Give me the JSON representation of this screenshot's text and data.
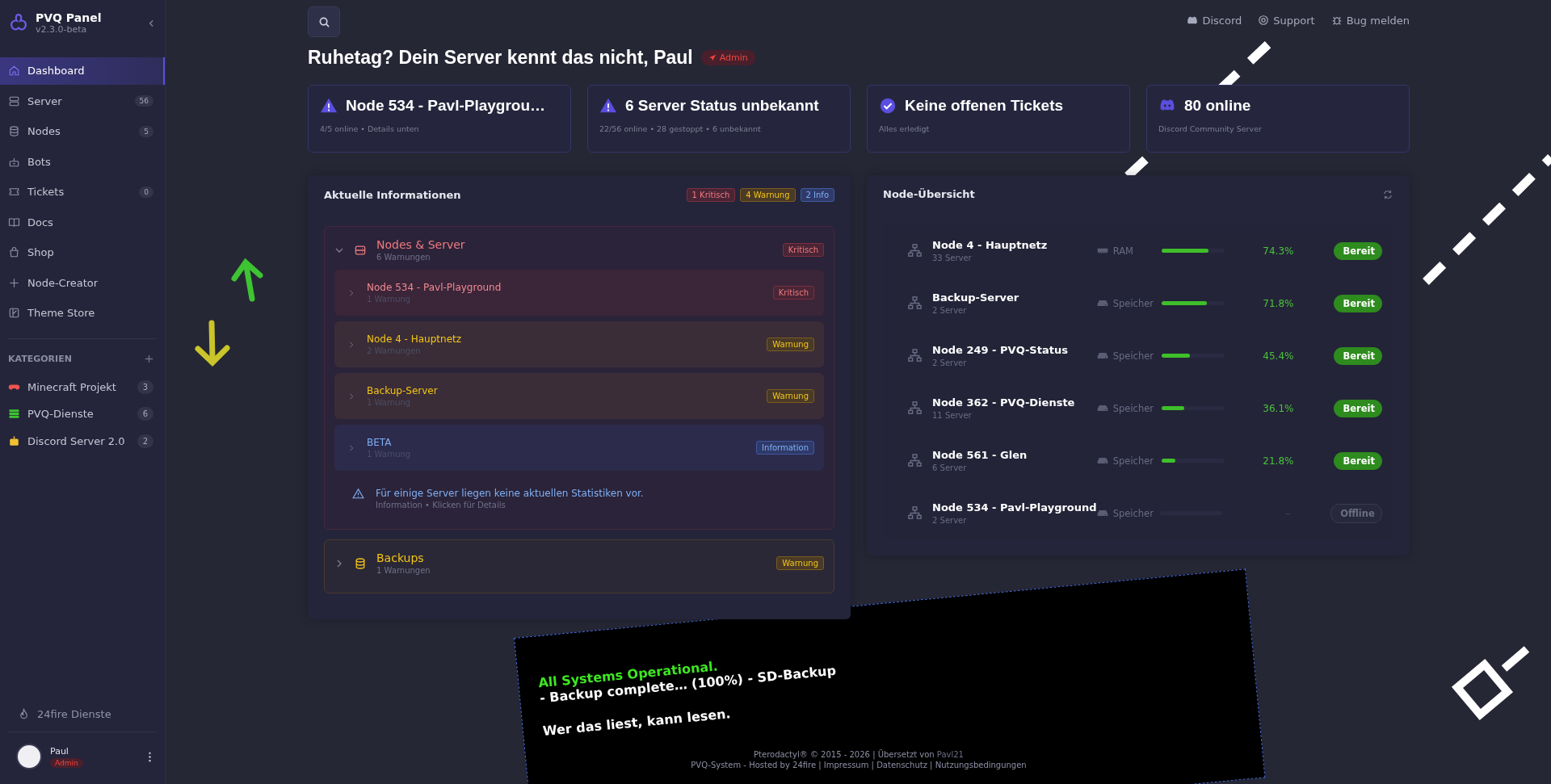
{
  "sidebar": {
    "brand": "PVQ Panel",
    "version": "v2.3.0-beta",
    "items": [
      {
        "label": "Dashboard",
        "selected": true
      },
      {
        "label": "Server",
        "count": "56",
        "selected": false
      },
      {
        "label": "Nodes",
        "count": "5",
        "selected": false
      },
      {
        "label": "Bots",
        "selected": false
      },
      {
        "label": "Tickets",
        "count": "0",
        "selected": false
      },
      {
        "label": "Docs",
        "selected": false
      },
      {
        "label": "Shop",
        "selected": false
      },
      {
        "label": "Node-Creator",
        "selected": false
      },
      {
        "label": "Theme Store",
        "selected": false
      }
    ],
    "categories_heading": "KATEGORIEN",
    "categories": [
      {
        "label": "Minecraft Projekt",
        "count": "3",
        "color": "#ef5350"
      },
      {
        "label": "PVQ-Dienste",
        "count": "6",
        "color": "#3ec432"
      },
      {
        "label": "Discord Server 2.0",
        "count": "2",
        "color": "#f2c230"
      }
    ],
    "footer_link": "24fire Dienste",
    "user": {
      "name": "Paul",
      "role": "Admin"
    }
  },
  "topbar": {
    "links": [
      "Discord",
      "Support",
      "Bug melden"
    ]
  },
  "greeting": "Ruhetag? Dein Server kennt das nicht, Paul",
  "role_badge": "Admin",
  "stat_cards": [
    {
      "title": "Node 534 - Pavl-Playgrou…",
      "subtitle": "4/5 online • Details unten"
    },
    {
      "title": "6 Server Status unbekannt",
      "subtitle": "22/56 online • 28 gestoppt • 6 unbekannt"
    },
    {
      "title": "Keine offenen Tickets",
      "subtitle": "Alles erledigt"
    },
    {
      "title": "80 online",
      "subtitle": "Discord Community Server"
    }
  ],
  "info_panel": {
    "title": "Aktuelle Informationen",
    "counts": [
      {
        "label": "1 Kritisch",
        "kind": "critical"
      },
      {
        "label": "4 Warnung",
        "kind": "warning"
      },
      {
        "label": "2 Info",
        "kind": "info"
      }
    ],
    "groups": [
      {
        "title": "Nodes & Server",
        "subtitle": "6 Warnungen",
        "kind": "critical",
        "badge": "Kritisch",
        "expanded": true,
        "items": [
          {
            "title": "Node 534 - Pavl-Playground",
            "subtitle": "1 Warnung",
            "kind": "critical",
            "badge": "Kritisch"
          },
          {
            "title": "Node 4 - Hauptnetz",
            "subtitle": "2 Warnungen",
            "kind": "warning",
            "badge": "Warnung"
          },
          {
            "title": "Backup-Server",
            "subtitle": "1 Warnung",
            "kind": "warning",
            "badge": "Warnung"
          },
          {
            "title": "BETA",
            "subtitle": "1 Warnung",
            "kind": "info",
            "badge": "Information"
          }
        ],
        "notice": {
          "text": "Für einige Server liegen keine aktuellen Statistiken vor.",
          "subtitle": "Information • Klicken für Details"
        }
      },
      {
        "title": "Backups",
        "subtitle": "1 Warnungen",
        "kind": "warning",
        "badge": "Warnung",
        "expanded": false
      }
    ]
  },
  "node_panel": {
    "title": "Node-Übersicht",
    "nodes": [
      {
        "name": "Node 4 - Hauptnetz",
        "servers": "33 Server",
        "kind": "ram",
        "metric": "RAM",
        "level": 0.743,
        "percent": "74.3%",
        "status": "Bereit",
        "online": true
      },
      {
        "name": "Backup-Server",
        "servers": "2 Server",
        "kind": "disk",
        "metric": "Speicher",
        "level": 0.718,
        "percent": "71.8%",
        "status": "Bereit",
        "online": true
      },
      {
        "name": "Node 249 - PVQ-Status",
        "servers": "2 Server",
        "kind": "disk",
        "metric": "Speicher",
        "level": 0.454,
        "percent": "45.4%",
        "status": "Bereit",
        "online": true
      },
      {
        "name": "Node 362 - PVQ-Dienste",
        "servers": "11 Server",
        "kind": "disk",
        "metric": "Speicher",
        "level": 0.361,
        "percent": "36.1%",
        "status": "Bereit",
        "online": true
      },
      {
        "name": "Node 561 - Glen",
        "servers": "6 Server",
        "kind": "disk",
        "metric": "Speicher",
        "level": 0.218,
        "percent": "21.8%",
        "status": "Bereit",
        "online": true
      },
      {
        "name": "Node 534 - Pavl-Playground",
        "servers": "2 Server",
        "kind": "disk",
        "metric": "Speicher",
        "percent": "–",
        "status": "Offline",
        "online": false
      }
    ]
  },
  "console": {
    "lines": [
      {
        "text": "All Systems Operational.",
        "kind": "success"
      },
      {
        "text": "-  Backup complete… (100%) - SD-Backup",
        "kind": "plain"
      },
      {
        "text": "Wer das liest, kann lesen.",
        "kind": "plain"
      }
    ]
  },
  "footer": {
    "line1": "Pterodactyl® © 2015 - 2026 | Übersetzt von",
    "author": "Pavl21",
    "line2": "PVQ-System - Hosted by 24fire | Impressum | Datenschutz | Nutzungsbedingungen"
  }
}
